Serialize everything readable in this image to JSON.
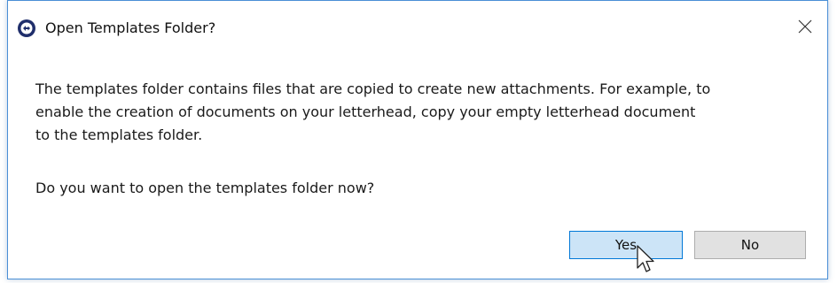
{
  "dialog": {
    "title": "Open Templates Folder?",
    "app_icon": "app-logo-icon",
    "close_icon": "close-icon",
    "message": "The templates folder contains files that are copied to create new attachments. For example, to\nenable the creation of documents on your letterhead, copy your empty letterhead document\nto the templates folder.",
    "question": "Do you want to open the templates folder now?",
    "buttons": {
      "yes_label": "Yes",
      "no_label": "No"
    }
  },
  "colors": {
    "window_border": "#4a8fd6",
    "default_button_fill": "#cce4f7",
    "default_button_border": "#0078d7",
    "button_fill": "#e1e1e1",
    "app_icon": "#1f2e6b"
  }
}
